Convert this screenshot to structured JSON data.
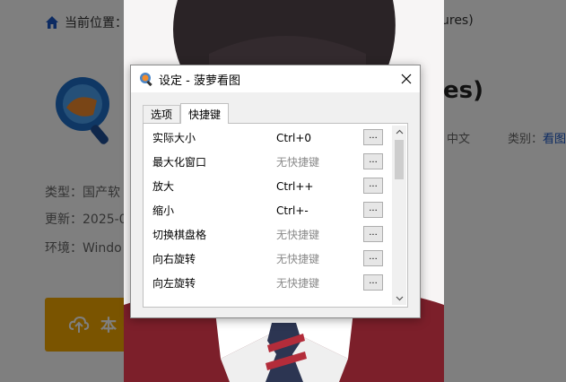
{
  "background_page": {
    "breadcrumb_label": "当前位置：",
    "breadcrumb_tail": "ures)",
    "title_tail": "es)",
    "language_tail": "中文",
    "category_label": "类别：",
    "category_value": "看图",
    "type_text": "类型：国产软",
    "updated_text": "更新：2025-0",
    "env_text": "环境：Windo",
    "download_label": "本"
  },
  "dialog": {
    "title": "设定 - 菠萝看图",
    "tabs": [
      {
        "label": "选项",
        "active": false
      },
      {
        "label": "快捷键",
        "active": true
      }
    ],
    "rows": [
      {
        "name": "实际大小",
        "shortcut": "Ctrl+0",
        "has_shortcut": true,
        "button": "..."
      },
      {
        "name": "最大化窗口",
        "shortcut": "无快捷键",
        "has_shortcut": false,
        "button": "..."
      },
      {
        "name": "放大",
        "shortcut": "Ctrl++",
        "has_shortcut": true,
        "button": "..."
      },
      {
        "name": "缩小",
        "shortcut": "Ctrl+-",
        "has_shortcut": true,
        "button": "..."
      },
      {
        "name": "切换棋盘格",
        "shortcut": "无快捷键",
        "has_shortcut": false,
        "button": "..."
      },
      {
        "name": "向右旋转",
        "shortcut": "无快捷键",
        "has_shortcut": false,
        "button": "..."
      },
      {
        "name": "向左旋转",
        "shortcut": "无快捷键",
        "has_shortcut": false,
        "button": "..."
      }
    ]
  },
  "colors": {
    "accent_link": "#1a56c4",
    "download_button": "#f5a800",
    "disabled_text": "#8a8a8a"
  },
  "icons": {
    "close": "close-icon",
    "app": "app-icon",
    "home": "home-icon",
    "scroll_up": "chevron-up-icon",
    "scroll_down": "chevron-down-icon"
  }
}
